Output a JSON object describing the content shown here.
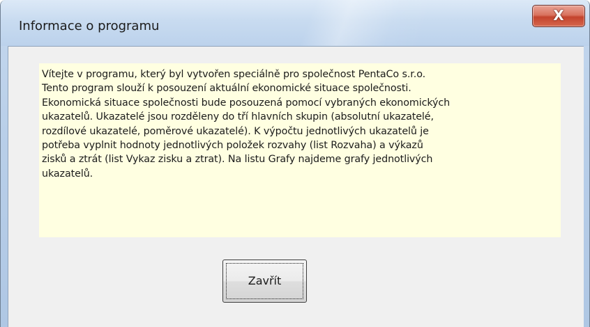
{
  "window": {
    "title": "Informace o programu",
    "close_icon": "close-icon",
    "close_glyph": "X"
  },
  "info": {
    "lines": [
      "Vítejte v programu, který byl vytvořen speciálně pro společnost PentaCo s.r.o.",
      "Tento program slouží k posouzení aktuální ekonomické situace společnosti.",
      "Ekonomická situace společnosti bude posouzená pomocí vybraných ekonomických",
      "ukazatelů. Ukazatelé jsou rozděleny do tří hlavních skupin (absolutní ukazatelé,",
      "rozdílové ukazatelé, poměrové ukazatelé). K výpočtu jednotlivých ukazatelů je",
      "potřeba vyplnit hodnoty jednotlivých položek rozvahy (list Rozvaha) a výkazů",
      "zisků a ztrát (list Vykaz zisku a ztrat). Na listu Grafy najdeme grafy jednotlivých",
      "ukazatelů."
    ]
  },
  "buttons": {
    "close_label": "Zavřít"
  },
  "colors": {
    "info_background": "#ffffe1",
    "dialog_background": "#f0f0f0",
    "close_button_red": "#c4442d"
  }
}
